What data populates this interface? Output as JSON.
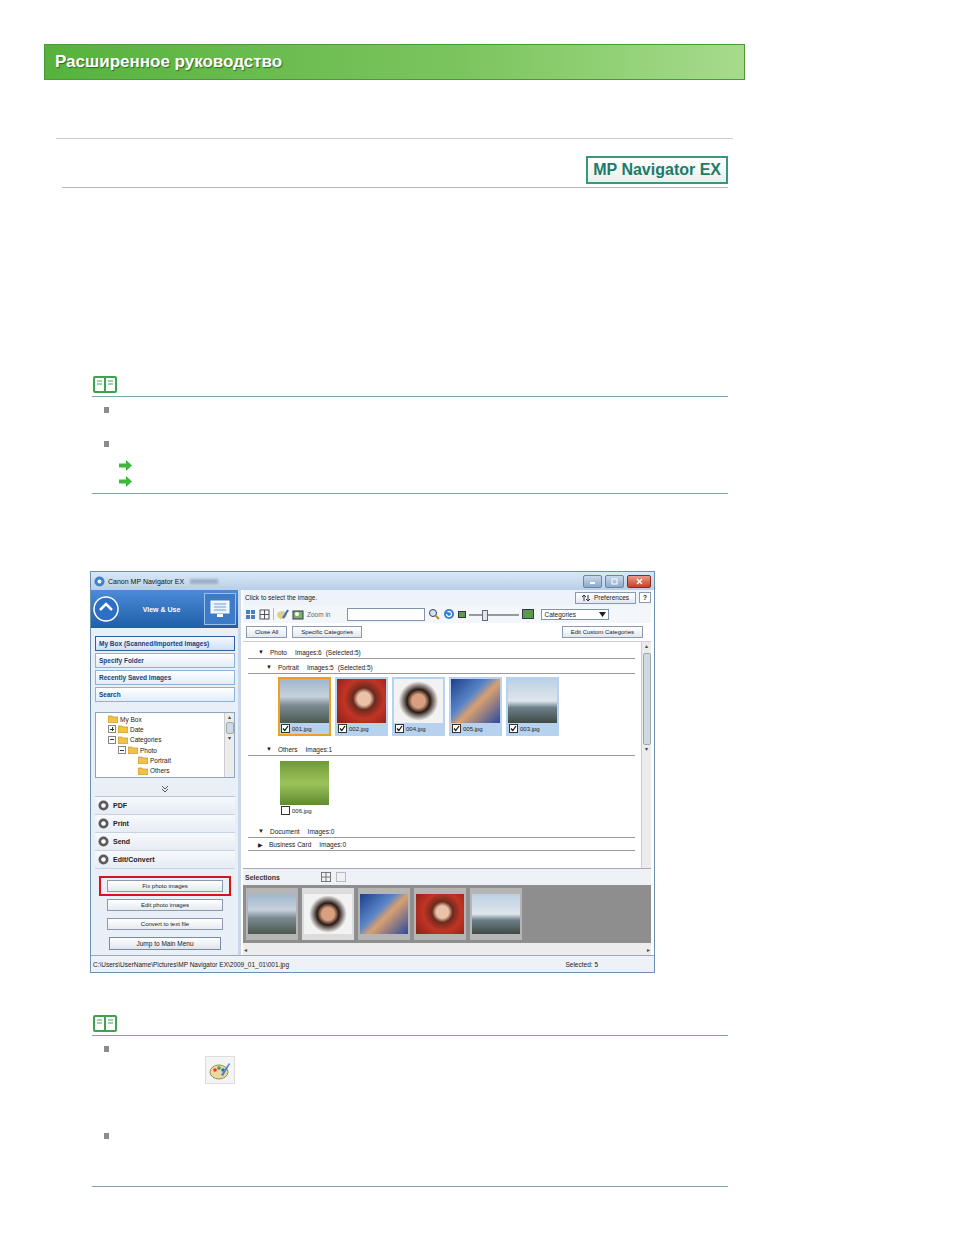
{
  "page": {
    "header": "Расширенное руководство",
    "badge": "MP Navigator EX"
  },
  "notes": [
    {
      "items": [
        {
          "kind": "bullet"
        },
        {
          "kind": "bullet"
        },
        {
          "kind": "link"
        },
        {
          "kind": "link"
        }
      ]
    },
    {
      "items": [
        {
          "kind": "bullet-icon"
        },
        {
          "kind": "bullet"
        }
      ]
    }
  ],
  "app": {
    "window": {
      "title": "Canon MP Navigator EX"
    },
    "mode": "View & Use",
    "nav": [
      {
        "label": "My Box (Scanned/Imported Images)",
        "selected": true
      },
      {
        "label": "Specify Folder",
        "selected": false
      },
      {
        "label": "Recently Saved Images",
        "selected": false
      },
      {
        "label": "Search",
        "selected": false
      }
    ],
    "tree": [
      {
        "label": "My Box",
        "depth": 0,
        "expandable": false,
        "expanded": true
      },
      {
        "label": "Date",
        "depth": 1,
        "expandable": true,
        "expanded": false
      },
      {
        "label": "Categories",
        "depth": 1,
        "expandable": true,
        "expanded": true
      },
      {
        "label": "Photo",
        "depth": 2,
        "expandable": true,
        "expanded": true
      },
      {
        "label": "Portrait",
        "depth": 3,
        "expandable": false,
        "expanded": false
      },
      {
        "label": "Others",
        "depth": 3,
        "expandable": false,
        "expanded": false
      }
    ],
    "actions": [
      {
        "label": "PDF"
      },
      {
        "label": "Print"
      },
      {
        "label": "Send"
      },
      {
        "label": "Edit/Convert"
      }
    ],
    "sub_buttons": [
      {
        "label": "Fix photo images",
        "highlighted": true
      },
      {
        "label": "Edit photo images",
        "highlighted": false
      },
      {
        "label": "Convert to text file",
        "highlighted": false
      }
    ],
    "jump": "Jump to Main Menu",
    "hint": "Click to select the image.",
    "preferences": "Preferences",
    "help": "?",
    "zoom": "Zoom in",
    "search": "",
    "zoom_slider": {
      "level": 0.3
    },
    "view": "Categories",
    "buttons": [
      "Close All",
      "Specific Categories",
      "Edit Custom Categories"
    ],
    "groups": [
      {
        "arrow": "▼",
        "name": "Photo",
        "count": "Images:6",
        "selected": "(Selected:5)",
        "nested": false,
        "images": []
      },
      {
        "arrow": "▼",
        "name": "Portrait",
        "count": "Images:5",
        "selected": "(Selected:5)",
        "nested": true,
        "images": [
          {
            "name": "001.jpg",
            "checked": true,
            "focused": true
          },
          {
            "name": "002.jpg",
            "checked": true,
            "focused": false
          },
          {
            "name": "004.jpg",
            "checked": true,
            "focused": false
          },
          {
            "name": "005.jpg",
            "checked": true,
            "focused": false
          },
          {
            "name": "003.jpg",
            "checked": true,
            "focused": false
          }
        ]
      },
      {
        "arrow": "▼",
        "name": "Others",
        "count": "Images:1",
        "nested": true,
        "images": [
          {
            "name": "006.jpg",
            "checked": false,
            "focused": false
          }
        ]
      },
      {
        "arrow": "▼",
        "name": "Document",
        "count": "Images:0",
        "nested": false,
        "images": []
      },
      {
        "arrow": "▶",
        "name": "Business Card",
        "count": "Images:0",
        "nested": false,
        "images": []
      }
    ],
    "selections_label": "Selections",
    "selections": [
      {
        "selected": false
      },
      {
        "selected": true
      },
      {
        "selected": false
      },
      {
        "selected": false
      },
      {
        "selected": false
      }
    ],
    "status": {
      "path": "C:\\Users\\UserName\\Pictures\\MP Navigator EX\\2009_01_01\\001.jpg",
      "selected": "Selected: 5"
    }
  }
}
